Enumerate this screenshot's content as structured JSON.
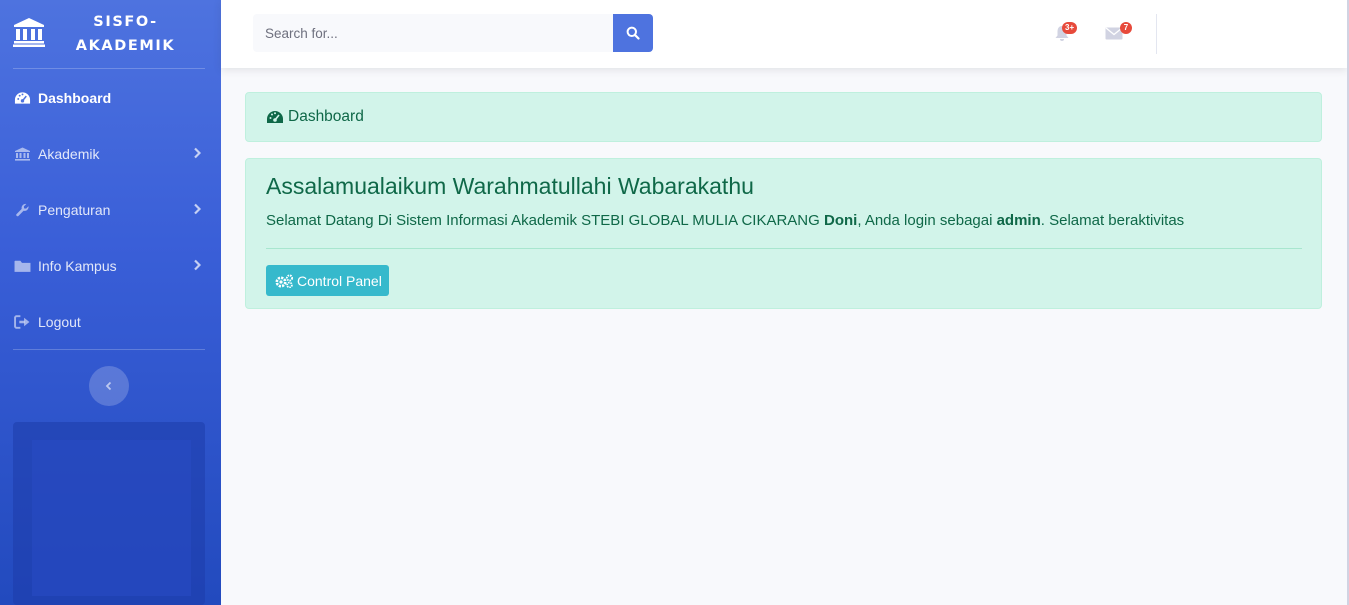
{
  "brand": {
    "line1": "SISFO-",
    "line2": "AKADEMIK",
    "icon": "university-icon"
  },
  "sidebar": {
    "items": [
      {
        "label": "Dashboard",
        "icon": "tachometer-icon",
        "active": true
      },
      {
        "label": "Akademik",
        "icon": "university-icon",
        "has_submenu": true
      },
      {
        "label": "Pengaturan",
        "icon": "wrench-icon",
        "has_submenu": true
      },
      {
        "label": "Info Kampus",
        "icon": "folder-icon",
        "has_submenu": true
      },
      {
        "label": "Logout",
        "icon": "sign-out-icon"
      }
    ],
    "toggle_icon": "chevron-left-icon"
  },
  "topbar": {
    "search": {
      "placeholder": "Search for...",
      "value": ""
    },
    "alerts": {
      "icon": "bell-icon",
      "badge": "3+"
    },
    "messages": {
      "icon": "envelope-icon",
      "badge": "7"
    }
  },
  "breadcrumb": {
    "label": "Dashboard",
    "icon": "tachometer-icon"
  },
  "welcome": {
    "title": "Assalamualaikum Warahmatullahi Wabarakathu",
    "text_prefix": "Selamat Datang Di Sistem Informasi Akademik STEBI GLOBAL MULIA CIKARANG ",
    "username": "Doni",
    "text_middle": ", Anda login sebagai ",
    "role": "admin",
    "text_suffix": ". Selamat beraktivitas",
    "button_label": "Control Panel",
    "button_icon": "cogs-icon"
  },
  "colors": {
    "sidebar": "#4e73df",
    "primary": "#4e73df",
    "alert_bg": "#d2f4ea",
    "alert_text": "#0f6848",
    "info_button": "#36b9cc",
    "badge": "#e74a3b"
  }
}
